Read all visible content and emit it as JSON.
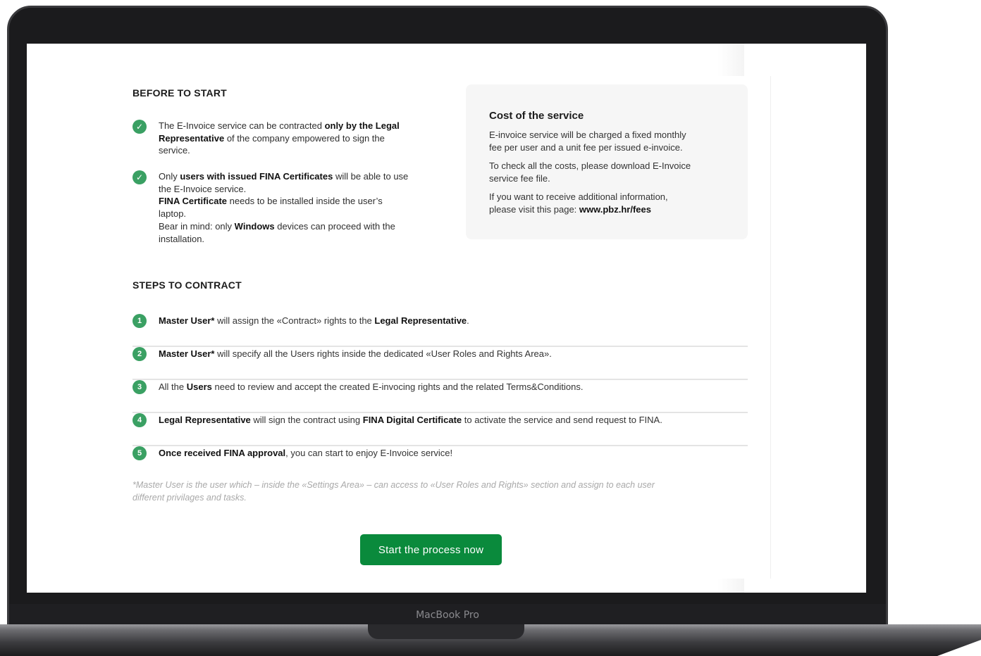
{
  "device": {
    "model_label": "MacBook Pro"
  },
  "before": {
    "title": "BEFORE TO START",
    "items": [
      {
        "lines": [
          [
            {
              "t": "The E-Invoice service can be contracted "
            },
            {
              "t": "only by the Legal",
              "b": true
            }
          ],
          [
            {
              "t": "Representative",
              "b": true
            },
            {
              "t": " of the company empowered to sign the"
            }
          ],
          [
            {
              "t": "service."
            }
          ]
        ]
      },
      {
        "lines": [
          [
            {
              "t": "Only "
            },
            {
              "t": "users with issued FINA Certificates",
              "b": true
            },
            {
              "t": " will be able to use"
            }
          ],
          [
            {
              "t": "the E-Invoice service."
            }
          ],
          [
            {
              "t": "FINA Certificate",
              "b": true
            },
            {
              "t": " needs to be installed inside the user’s"
            }
          ],
          [
            {
              "t": "laptop."
            }
          ],
          [
            {
              "t": "Bear in mind: only "
            },
            {
              "t": "Windows",
              "b": true
            },
            {
              "t": " devices can proceed with the"
            }
          ],
          [
            {
              "t": "installation."
            }
          ]
        ]
      }
    ]
  },
  "cost": {
    "title": "Cost of the service",
    "paragraphs": [
      {
        "lines": [
          [
            {
              "t": "E-invoice service will be charged a fixed monthly"
            }
          ],
          [
            {
              "t": "fee per user and a unit fee per issued e-invoice."
            }
          ]
        ]
      },
      {
        "lines": [
          [
            {
              "t": "To check all the costs, please download E-Invoice"
            }
          ],
          [
            {
              "t": "service fee file."
            }
          ]
        ]
      },
      {
        "lines": [
          [
            {
              "t": "If you want to receive additional information,"
            }
          ],
          [
            {
              "t": "please visit this page: "
            },
            {
              "t": "www.pbz.hr/fees",
              "b": true
            }
          ]
        ]
      }
    ]
  },
  "steps": {
    "title": "STEPS TO CONTRACT",
    "items": [
      {
        "num": "1",
        "parts": [
          {
            "t": "Master User*",
            "b": true
          },
          {
            "t": "  will assign the «Contract» rights to the "
          },
          {
            "t": "Legal Representative",
            "b": true
          },
          {
            "t": "."
          }
        ]
      },
      {
        "num": "2",
        "parts": [
          {
            "t": "Master User*",
            "b": true
          },
          {
            "t": "  will specify all the Users rights inside the dedicated «User Roles and Rights Area»."
          }
        ]
      },
      {
        "num": "3",
        "parts": [
          {
            "t": "All the "
          },
          {
            "t": "Users",
            "b": true
          },
          {
            "t": " need to review and accept the created E-invocing rights and the related Terms&Conditions."
          }
        ]
      },
      {
        "num": "4",
        "parts": [
          {
            "t": "Legal Representative",
            "b": true
          },
          {
            "t": " will sign the contract using "
          },
          {
            "t": "FINA Digital Certificate",
            "b": true
          },
          {
            "t": " to activate the service and send request to FINA."
          }
        ]
      },
      {
        "num": "5",
        "parts": [
          {
            "t": "Once received FINA approval",
            "b": true
          },
          {
            "t": ", you can start to enjoy E-Invoice service!"
          }
        ]
      }
    ]
  },
  "footnote": {
    "lines": [
      "*Master User is the user which – inside the «Settings Area» – can access to «User Roles and Rights» section and assign to each user",
      "different privilages and tasks."
    ]
  },
  "cta": {
    "label": "Start the process now"
  },
  "colors": {
    "accent_green": "#3aa063",
    "button_green": "#0a8a3c",
    "card_bg": "#f6f6f6"
  }
}
